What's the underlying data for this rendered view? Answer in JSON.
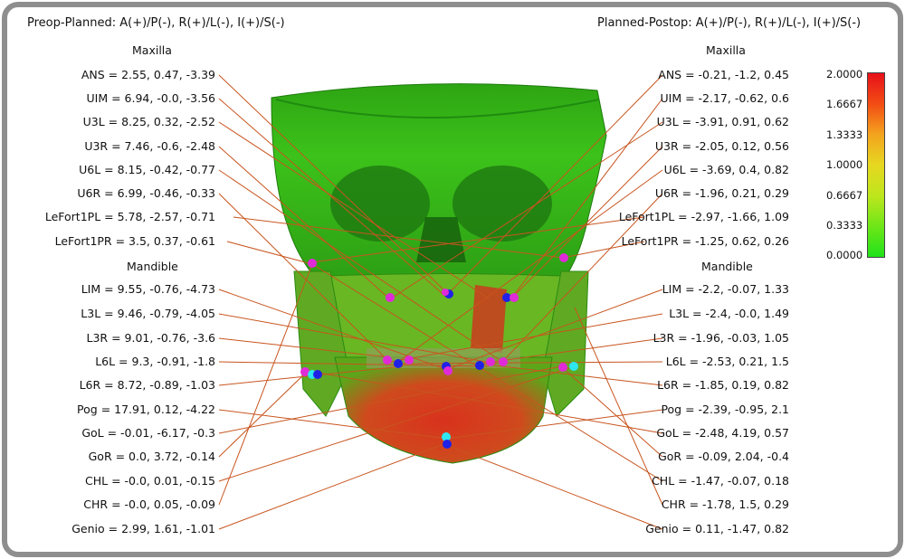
{
  "left_panel": {
    "title": "Preop-Planned: A(+)/P(-), R(+)/L(-), I(+)/S(-)",
    "maxilla_label": "Maxilla",
    "mandible_label": "Mandible",
    "maxilla": [
      {
        "name": "ANS",
        "value": "ANS = 2.55, 0.47, -3.39"
      },
      {
        "name": "UIM",
        "value": "UIM = 6.94, -0.0, -3.56"
      },
      {
        "name": "U3L",
        "value": "U3L = 8.25, 0.32, -2.52"
      },
      {
        "name": "U3R",
        "value": "U3R = 7.46, -0.6, -2.48"
      },
      {
        "name": "U6L",
        "value": "U6L = 8.15, -0.42, -0.77"
      },
      {
        "name": "U6R",
        "value": "U6R = 6.99, -0.46, -0.33"
      },
      {
        "name": "LeFort1PL",
        "value": "LeFort1PL = 5.78, -2.57, -0.71"
      },
      {
        "name": "LeFort1PR",
        "value": "LeFort1PR = 3.5, 0.37, -0.61"
      }
    ],
    "mandible": [
      {
        "name": "LIM",
        "value": "LIM = 9.55, -0.76, -4.73"
      },
      {
        "name": "L3L",
        "value": "L3L = 9.46, -0.79, -4.05"
      },
      {
        "name": "L3R",
        "value": "L3R = 9.01, -0.76, -3.6"
      },
      {
        "name": "L6L",
        "value": "L6L = 9.3, -0.91, -1.8"
      },
      {
        "name": "L6R",
        "value": "L6R = 8.72, -0.89, -1.03"
      },
      {
        "name": "Pog",
        "value": "Pog = 17.91, 0.12, -4.22"
      },
      {
        "name": "GoL",
        "value": "GoL = -0.01, -6.17, -0.3"
      },
      {
        "name": "GoR",
        "value": "GoR = 0.0, 3.72, -0.14"
      },
      {
        "name": "CHL",
        "value": "CHL = -0.0, 0.01, -0.15"
      },
      {
        "name": "CHR",
        "value": "CHR = -0.0, 0.05, -0.09"
      },
      {
        "name": "Genio",
        "value": "Genio = 2.99, 1.61, -1.01"
      }
    ]
  },
  "right_panel": {
    "title": "Planned-Postop: A(+)/P(-), R(+)/L(-), I(+)/S(-)",
    "maxilla_label": "Maxilla",
    "mandible_label": "Mandible",
    "maxilla": [
      {
        "name": "ANS",
        "value": "ANS = -0.21, -1.2, 0.45"
      },
      {
        "name": "UIM",
        "value": "UIM = -2.17, -0.62, 0.6"
      },
      {
        "name": "U3L",
        "value": "U3L = -3.91, 0.91, 0.62"
      },
      {
        "name": "U3R",
        "value": "U3R = -2.05, 0.12, 0.56"
      },
      {
        "name": "U6L",
        "value": "U6L = -3.69, 0.4, 0.82"
      },
      {
        "name": "U6R",
        "value": "U6R = -1.96, 0.21, 0.29"
      },
      {
        "name": "LeFort1PL",
        "value": "LeFort1PL = -2.97, -1.66, 1.09"
      },
      {
        "name": "LeFort1PR",
        "value": "LeFort1PR = -1.25, 0.62, 0.26"
      }
    ],
    "mandible": [
      {
        "name": "LIM",
        "value": "LIM = -2.2, -0.07, 1.33"
      },
      {
        "name": "L3L",
        "value": "L3L = -2.4, -0.0, 1.49"
      },
      {
        "name": "L3R",
        "value": "L3R = -1.96, -0.03, 1.05"
      },
      {
        "name": "L6L",
        "value": "L6L = -2.53, 0.21, 1.5"
      },
      {
        "name": "L6R",
        "value": "L6R = -1.85, 0.19, 0.82"
      },
      {
        "name": "Pog",
        "value": "Pog = -2.39, -0.95, 2.1"
      },
      {
        "name": "GoL",
        "value": "GoL = -2.48, 4.19, 0.57"
      },
      {
        "name": "GoR",
        "value": "GoR = -0.09, 2.04, -0.4"
      },
      {
        "name": "CHL",
        "value": "CHL = -1.47, -0.07, 0.18"
      },
      {
        "name": "CHR",
        "value": "CHR = -1.78, 1.5, 0.29"
      },
      {
        "name": "Genio",
        "value": "Genio = 0.11, -1.47, 0.82"
      }
    ]
  },
  "colorbar": {
    "ticks": [
      "2.0000",
      "1.6667",
      "1.3333",
      "1.0000",
      "0.6667",
      "0.3333",
      "0.0000"
    ],
    "range": [
      0,
      2
    ],
    "colors": [
      "#21e31a",
      "#6fe618",
      "#bde61d",
      "#e6d820",
      "#f4a21e",
      "#f24e14",
      "#e8101a"
    ]
  },
  "colors": {
    "leader_line": "#c8551f",
    "marker_magenta": "#e02ad8",
    "marker_blue": "#1f22e6",
    "marker_cyan": "#2ee6f0",
    "mesh_green": "#2fd11a",
    "mesh_red": "#d8281e"
  }
}
